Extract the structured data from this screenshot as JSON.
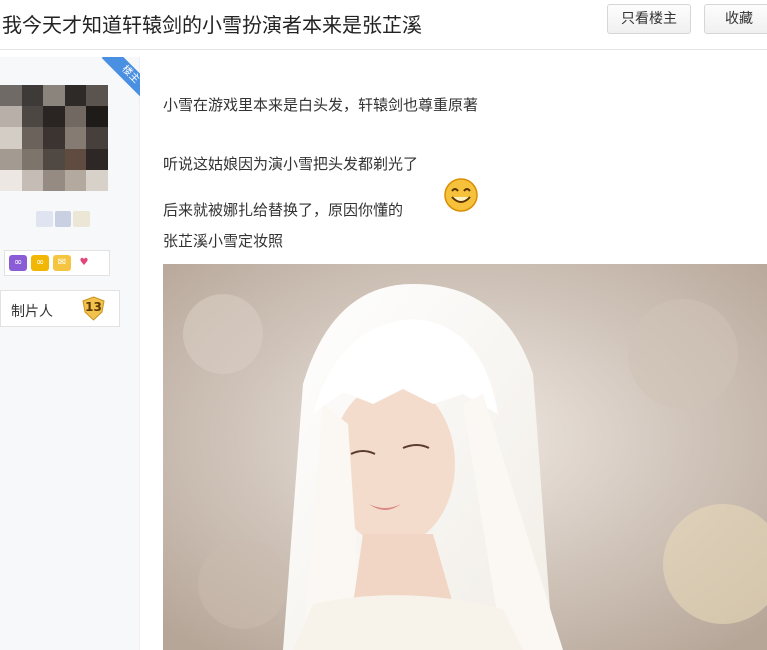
{
  "header": {
    "title": "我今天才知道轩辕剑的小雪扮演者本来是张芷溪",
    "only_op_label": "只看楼主",
    "favorite_label": "收藏"
  },
  "author": {
    "op_badge": "楼主",
    "role_label": "制片人",
    "level": "13"
  },
  "post": {
    "lines": [
      "小雪在游戏里本来是白头发，轩辕剑也尊重原著",
      "听说这姑娘因为演小雪把头发都剃光了",
      "后来就被娜扎给替换了，原因你懂的",
      "张芷溪小雪定妆照"
    ],
    "emoji": "smiley-face",
    "image": "actress-white-hair-photo"
  },
  "colors": {
    "ribbon": "#4a90e2",
    "level_badge": "#f2c14e"
  }
}
